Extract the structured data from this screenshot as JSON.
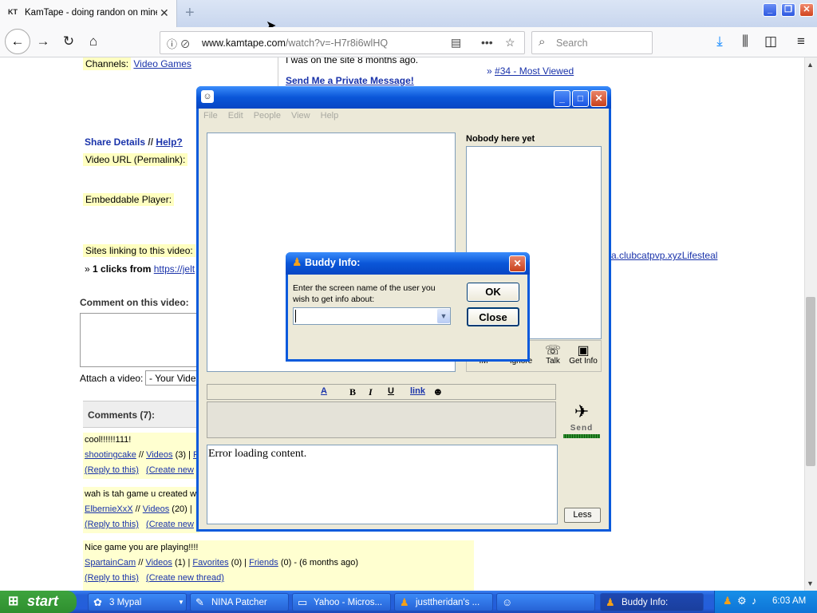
{
  "browser": {
    "tab_title": "KamTape - doing randon on minec",
    "tab_favicon_text": "KT",
    "url_domain": "www.kamtape.com",
    "url_path": "/watch?v=-H7r8i6wlHQ",
    "search_placeholder": "Search"
  },
  "page": {
    "channels_label": "Channels:",
    "channels_value": "Video Games",
    "last_seen_text": "I was on the site 8 months ago.",
    "private_message_link": "Send Me a Private Message!",
    "most_viewed_link": "#34 - Most Viewed",
    "share_details": "Share Details",
    "share_sep": "//",
    "help_link": "Help?",
    "video_url_label": "Video URL (Permalink):",
    "embeddable_label": "Embeddable Player:",
    "sites_linking_label": "Sites linking to this video:",
    "clicks_text": "1 clicks from",
    "clicks_link": "https://jelt",
    "right_link_fragment": "a.clubcatpvp.xyzLifesteal",
    "comment_on_video": "Comment on this video:",
    "attach_video_label": "Attach a video:",
    "attach_select_value": "- Your Vide",
    "comments_header": "Comments (7):",
    "comments": [
      {
        "text": "cool!!!!!!111!",
        "user": "shootingcake",
        "videos": "Videos",
        "videos_count": "(3) |",
        "reply": "(Reply to this)",
        "create": "(Create new"
      },
      {
        "text": "wah is tah game u created w",
        "user": "ElbernieXxX",
        "videos": "Videos",
        "videos_count": "(20) |",
        "reply": "(Reply to this)",
        "create": "(Create new"
      },
      {
        "text": "Nice game you are playing!!!!",
        "user": "SpartainCam",
        "videos": "Videos",
        "videos_count": "(1) |",
        "favorites": "Favorites",
        "favorites_count": "(0) |",
        "friends": "Friends",
        "friends_count": "(0) - (6 months ago)",
        "reply": "(Reply to this)",
        "create": "(Create new thread)"
      }
    ]
  },
  "messenger": {
    "menu": [
      "File",
      "Edit",
      "People",
      "View",
      "Help"
    ],
    "buddy_header": "Nobody here yet",
    "toolbar": {
      "im": "IM",
      "ignore": "Ignore",
      "talk": "Talk",
      "get_info": "Get Info"
    },
    "format": {
      "color": "A",
      "bold": "B",
      "italic": "I",
      "underline": "U",
      "link": "link"
    },
    "send_label": "Send",
    "error_text": "Error loading content.",
    "less_button": "Less"
  },
  "dialog": {
    "title": "Buddy Info:",
    "prompt": "Enter the screen name of the user you wish to get info about:",
    "input_value": "",
    "ok": "OK",
    "close": "Close"
  },
  "taskbar": {
    "start": "start",
    "tasks": [
      "3 Mypal",
      "NINA Patcher",
      "Yahoo - Micros...",
      "justtheridan's ...",
      "",
      "Buddy Info:"
    ],
    "clock": "6:03 AM"
  }
}
